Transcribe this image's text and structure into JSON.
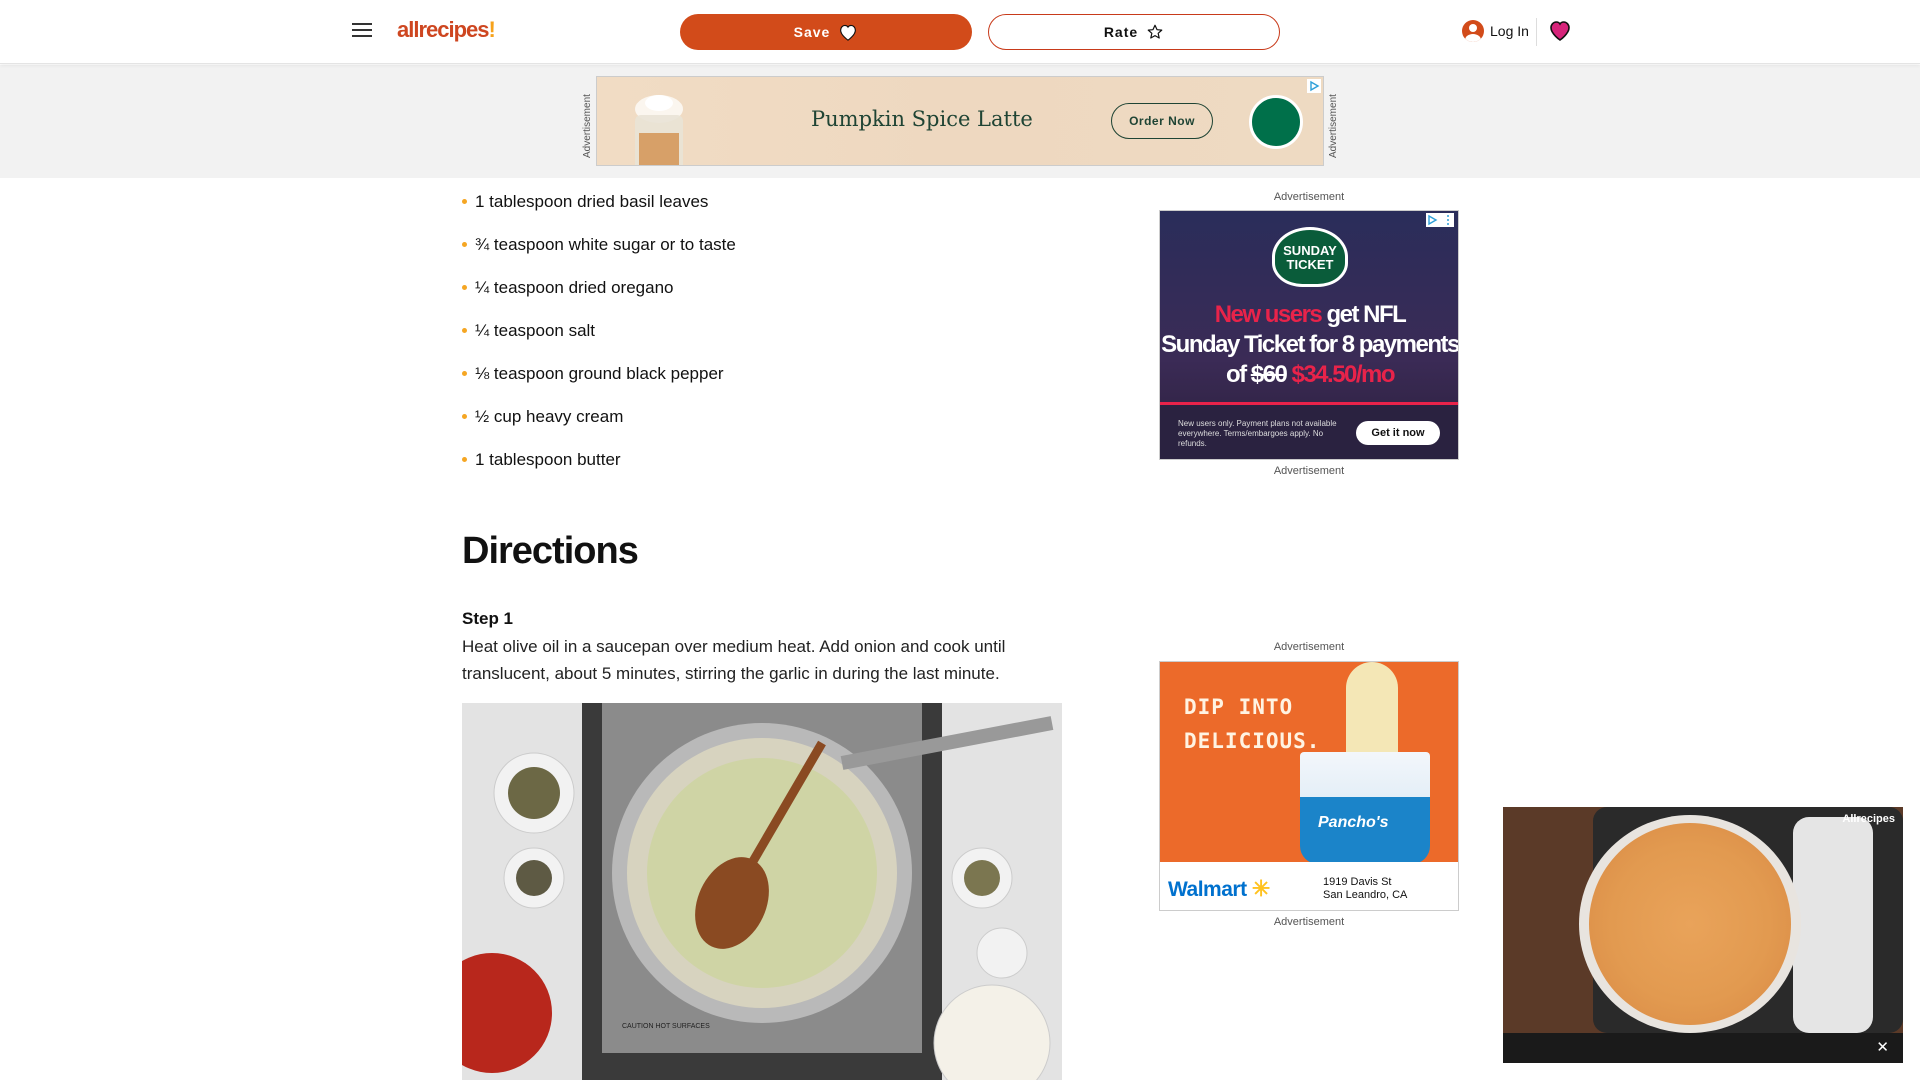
{
  "header": {
    "logo_text": "allrecipes",
    "logo_mark": "!",
    "save_label": "Save",
    "rate_label": "Rate",
    "login_label": "Log In"
  },
  "top_ad": {
    "label": "Advertisement",
    "headline": "Pumpkin Spice Latte",
    "cta": "Order Now"
  },
  "ingredients": [
    "1 tablespoon dried basil leaves",
    "¾ teaspoon white sugar or to taste",
    "¼ teaspoon dried oregano",
    "¼ teaspoon salt",
    "⅛ teaspoon ground black pepper",
    "½ cup heavy cream",
    "1 tablespoon butter"
  ],
  "directions": {
    "title": "Directions",
    "step1_title": "Step 1",
    "step1_text": "Heat olive oil in a saucepan over medium heat. Add onion and cook until translucent, about 5 minutes, stirring the garlic in during the last minute."
  },
  "rail": {
    "ad_label": "Advertisement",
    "nfl": {
      "badge": "SUNDAY TICKET",
      "line1_red": "New users",
      "line1_rest": " get NFL",
      "line2": "Sunday Ticket for 8 payments",
      "line3_of": "of ",
      "line3_old": "$60",
      "line3_new": " $34.50/mo",
      "fine": "New users only. Payment plans not available everywhere. Terms/embargoes apply. No refunds.",
      "cta": "Get it now"
    },
    "queso": {
      "headline_1": "DIP INTO",
      "headline_2": "DELICIOUS.",
      "brand": "Pancho's",
      "retailer": "Walmart",
      "address_1": "1919 Davis St",
      "address_2": "San Leandro, CA"
    }
  },
  "video": {
    "brand": "Allrecipes",
    "close": "✕"
  },
  "colors": {
    "brand": "#ce4620",
    "save_button": "#d24b1a",
    "bullet": "#f5a623"
  }
}
